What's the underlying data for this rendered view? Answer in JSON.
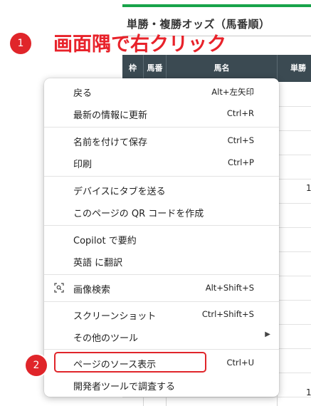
{
  "page": {
    "odds_title": "単勝・複勝オッズ（馬番順）",
    "table": {
      "headers": [
        "枠",
        "馬番",
        "馬名",
        "単勝"
      ],
      "peek_values": [
        "1",
        "1"
      ]
    }
  },
  "annotation": {
    "step1_badge": "1",
    "step1_text": "画面隅で右クリック",
    "step2_badge": "2",
    "accent_color": "#e0252a"
  },
  "context_menu": {
    "groups": [
      [
        {
          "label": "戻る",
          "shortcut": "Alt+左矢印"
        },
        {
          "label": "最新の情報に更新",
          "shortcut": "Ctrl+R"
        }
      ],
      [
        {
          "label": "名前を付けて保存",
          "shortcut": "Ctrl+S"
        },
        {
          "label": "印刷",
          "shortcut": "Ctrl+P"
        }
      ],
      [
        {
          "label": "デバイスにタブを送る",
          "shortcut": ""
        },
        {
          "label": "このページの QR コードを作成",
          "shortcut": ""
        }
      ],
      [
        {
          "label": "Copilot で要約",
          "shortcut": ""
        },
        {
          "label": "英語 に翻訳",
          "shortcut": ""
        }
      ],
      [
        {
          "label": "画像検索",
          "shortcut": "Alt+Shift+S",
          "icon": "image-search-icon"
        }
      ],
      [
        {
          "label": "スクリーンショット",
          "shortcut": "Ctrl+Shift+S"
        },
        {
          "label": "その他のツール",
          "shortcut": "",
          "submenu": true,
          "icon": "chevron-right-icon"
        }
      ],
      [
        {
          "label": "ページのソース表示",
          "shortcut": "Ctrl+U"
        },
        {
          "label": "開発者ツールで調査する",
          "shortcut": ""
        }
      ]
    ]
  }
}
